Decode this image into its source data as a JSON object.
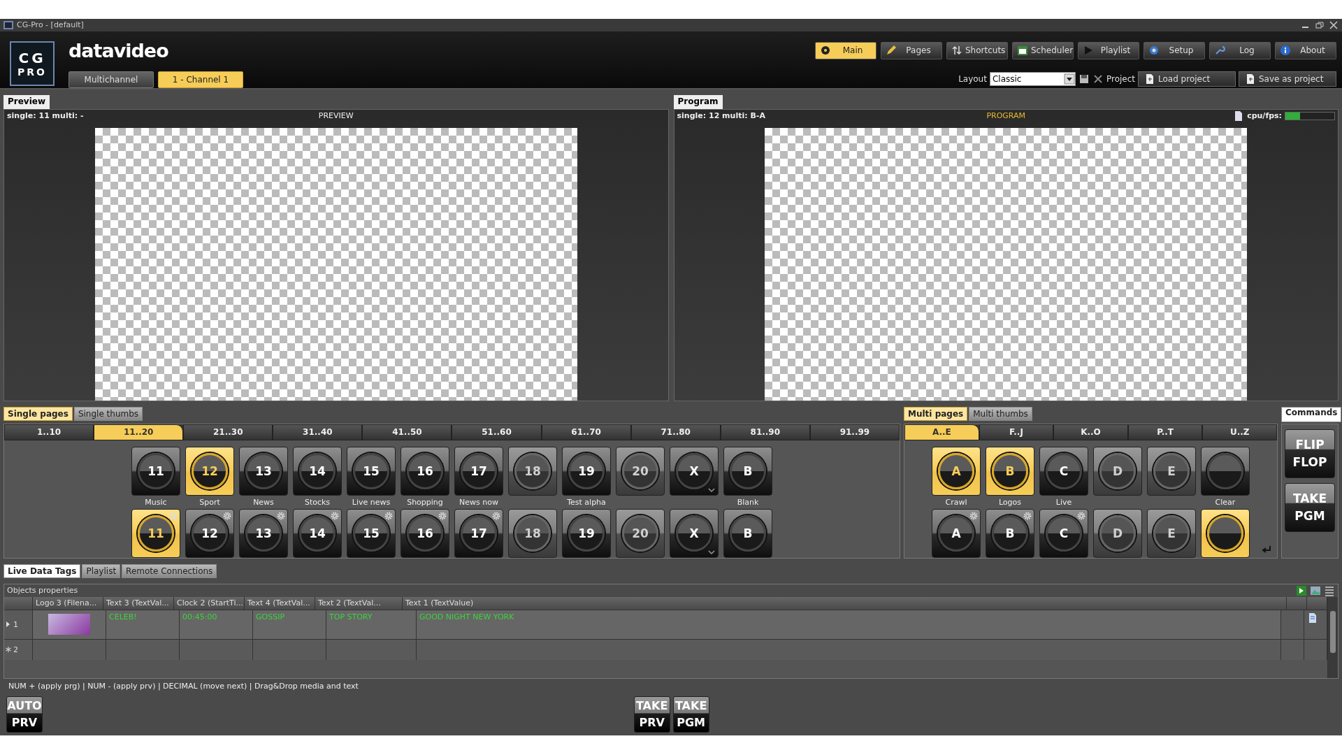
{
  "window": {
    "title": "CG-Pro - [default]"
  },
  "header": {
    "logo_top": "CG",
    "logo_bottom": "PRO",
    "brand": "datavideo",
    "channels": [
      {
        "label": "Multichannel",
        "selected": false
      },
      {
        "label": "1 - Channel 1",
        "selected": true
      }
    ],
    "nav": [
      {
        "label": "Main",
        "selected": true
      },
      {
        "label": "Pages",
        "selected": false
      },
      {
        "label": "Shortcuts",
        "selected": false
      },
      {
        "label": "Scheduler",
        "selected": false
      },
      {
        "label": "Playlist",
        "selected": false
      },
      {
        "label": "Setup",
        "selected": false
      },
      {
        "label": "Log",
        "selected": false
      },
      {
        "label": "About",
        "selected": false
      }
    ],
    "layout_label": "Layout",
    "layout_value": "Classic",
    "project_label": "Project",
    "project_buttons": [
      {
        "label": "Load project"
      },
      {
        "label": "Save as project"
      }
    ]
  },
  "preview": {
    "tab": "Preview",
    "status": "single: 11 multi: -",
    "caption": "PREVIEW"
  },
  "program": {
    "tab": "Program",
    "status": "single: 12 multi: B-A",
    "caption": "PROGRAM",
    "cpu_label": "cpu/fps:",
    "cpu_meter": {
      "level": 0.3
    }
  },
  "single_pages": {
    "tabs": [
      {
        "label": "Single pages",
        "selected": true
      },
      {
        "label": "Single thumbs",
        "selected": false
      }
    ],
    "ranges": [
      {
        "label": "1..10",
        "selected": false
      },
      {
        "label": "11..20",
        "selected": true
      },
      {
        "label": "21..30",
        "selected": false
      },
      {
        "label": "31..40",
        "selected": false
      },
      {
        "label": "41..50",
        "selected": false
      },
      {
        "label": "51..60",
        "selected": false
      },
      {
        "label": "61..70",
        "selected": false
      },
      {
        "label": "71..80",
        "selected": false
      },
      {
        "label": "81..90",
        "selected": false
      },
      {
        "label": "91..99",
        "selected": false
      }
    ],
    "columns": [
      {
        "caption": "Music",
        "top": {
          "label": "11",
          "selected": false,
          "disabled": false,
          "caret": false
        },
        "bottom": {
          "label": "11",
          "selected": true,
          "disabled": false,
          "gear": true,
          "caret": false
        }
      },
      {
        "caption": "Sport",
        "top": {
          "label": "12",
          "selected": true,
          "disabled": false,
          "caret": false
        },
        "bottom": {
          "label": "12",
          "selected": false,
          "disabled": false,
          "gear": true,
          "caret": false
        }
      },
      {
        "caption": "News",
        "top": {
          "label": "13",
          "selected": false,
          "disabled": false,
          "caret": false
        },
        "bottom": {
          "label": "13",
          "selected": false,
          "disabled": false,
          "gear": true,
          "caret": false
        }
      },
      {
        "caption": "Stocks",
        "top": {
          "label": "14",
          "selected": false,
          "disabled": false,
          "caret": false
        },
        "bottom": {
          "label": "14",
          "selected": false,
          "disabled": false,
          "gear": true,
          "caret": false
        }
      },
      {
        "caption": "Live news",
        "top": {
          "label": "15",
          "selected": false,
          "disabled": false,
          "caret": false
        },
        "bottom": {
          "label": "15",
          "selected": false,
          "disabled": false,
          "gear": true,
          "caret": false
        }
      },
      {
        "caption": "Shopping",
        "top": {
          "label": "16",
          "selected": false,
          "disabled": false,
          "caret": false
        },
        "bottom": {
          "label": "16",
          "selected": false,
          "disabled": false,
          "gear": true,
          "caret": false
        }
      },
      {
        "caption": "News now",
        "top": {
          "label": "17",
          "selected": false,
          "disabled": false,
          "caret": false
        },
        "bottom": {
          "label": "17",
          "selected": false,
          "disabled": false,
          "gear": true,
          "caret": false
        }
      },
      {
        "top": {
          "label": "18",
          "selected": false,
          "disabled": true,
          "caret": false
        },
        "bottom": {
          "label": "18",
          "selected": false,
          "disabled": true,
          "gear": false,
          "caret": false
        }
      },
      {
        "caption": "Test alpha",
        "top": {
          "label": "19",
          "selected": false,
          "disabled": false,
          "caret": false
        },
        "bottom": {
          "label": "19",
          "selected": false,
          "disabled": false,
          "gear": false,
          "caret": false
        }
      },
      {
        "top": {
          "label": "20",
          "selected": false,
          "disabled": true,
          "caret": false
        },
        "bottom": {
          "label": "20",
          "selected": false,
          "disabled": true,
          "gear": false,
          "caret": false
        }
      },
      {
        "top": {
          "label": "X",
          "selected": false,
          "disabled": false,
          "caret": true
        },
        "bottom": {
          "label": "X",
          "selected": false,
          "disabled": false,
          "gear": false,
          "caret": true
        }
      },
      {
        "caption": "Blank",
        "top": {
          "label": "B",
          "selected": false,
          "disabled": false,
          "caret": false
        },
        "bottom": {
          "label": "B",
          "selected": false,
          "disabled": false,
          "gear": false,
          "caret": false
        }
      }
    ]
  },
  "multi_pages": {
    "tabs": [
      {
        "label": "Multi pages",
        "selected": true
      },
      {
        "label": "Multi thumbs",
        "selected": false
      }
    ],
    "ranges": [
      {
        "label": "A..E",
        "selected": true
      },
      {
        "label": "F..J",
        "selected": false
      },
      {
        "label": "K..O",
        "selected": false
      },
      {
        "label": "P..T",
        "selected": false
      },
      {
        "label": "U..Z",
        "selected": false
      }
    ],
    "columns": [
      {
        "caption": "Crawl",
        "top": {
          "label": "A",
          "selected": true,
          "disabled": false
        },
        "bottom": {
          "label": "A",
          "selected": false,
          "disabled": false,
          "gear": true
        }
      },
      {
        "caption": "Logos",
        "top": {
          "label": "B",
          "selected": true,
          "disabled": false
        },
        "bottom": {
          "label": "B",
          "selected": false,
          "disabled": false,
          "gear": true
        }
      },
      {
        "caption": "Live",
        "top": {
          "label": "C",
          "selected": false,
          "disabled": false
        },
        "bottom": {
          "label": "C",
          "selected": false,
          "disabled": false,
          "gear": true
        }
      },
      {
        "top": {
          "label": "D",
          "selected": false,
          "disabled": true
        },
        "bottom": {
          "label": "D",
          "selected": false,
          "disabled": true,
          "gear": false
        }
      },
      {
        "top": {
          "label": "E",
          "selected": false,
          "disabled": true
        },
        "bottom": {
          "label": "E",
          "selected": false,
          "disabled": true,
          "gear": false
        }
      },
      {
        "caption": "Clear",
        "top": {
          "selected": false,
          "disabled": false
        },
        "bottom": {
          "selected": true,
          "disabled": false,
          "gear": false
        }
      }
    ]
  },
  "commands": {
    "tab": "Commands",
    "buttons": [
      {
        "top": "FLIP",
        "bottom": "FLOP"
      },
      {
        "top": "TAKE",
        "bottom": "PGM"
      }
    ]
  },
  "bottom_tabs": [
    {
      "label": "Live Data Tags",
      "selected": true
    },
    {
      "label": "Playlist",
      "selected": false
    },
    {
      "label": "Remote Connections",
      "selected": false
    }
  ],
  "objects": {
    "title": "Objects properties",
    "columns": [
      "Logo 3 (Filena...",
      "Text 3 (TextVal...",
      "Clock 2 (StartTi...",
      "Text 4 (TextVal...",
      "Text 2 (TextVal...",
      "Text 1 (TextValue)"
    ],
    "rows": [
      {
        "number": "1",
        "kind": "current",
        "thumbnail": true,
        "cells": [
          "CELEB!",
          "00:45:00",
          "GOSSIP",
          "TOP STORY",
          "GOOD NIGHT NEW YORK"
        ]
      },
      {
        "number": "2",
        "kind": "new",
        "thumbnail": false
      }
    ]
  },
  "hint": "NUM + (apply prg) | NUM - (apply prv) | DECIMAL (move next) | Drag&Drop media and text",
  "bottom_buttons": [
    {
      "top": "AUTO",
      "bottom": "PRV"
    },
    {
      "top": "TAKE",
      "bottom": "PRV"
    },
    {
      "top": "TAKE",
      "bottom": "PGM"
    }
  ]
}
